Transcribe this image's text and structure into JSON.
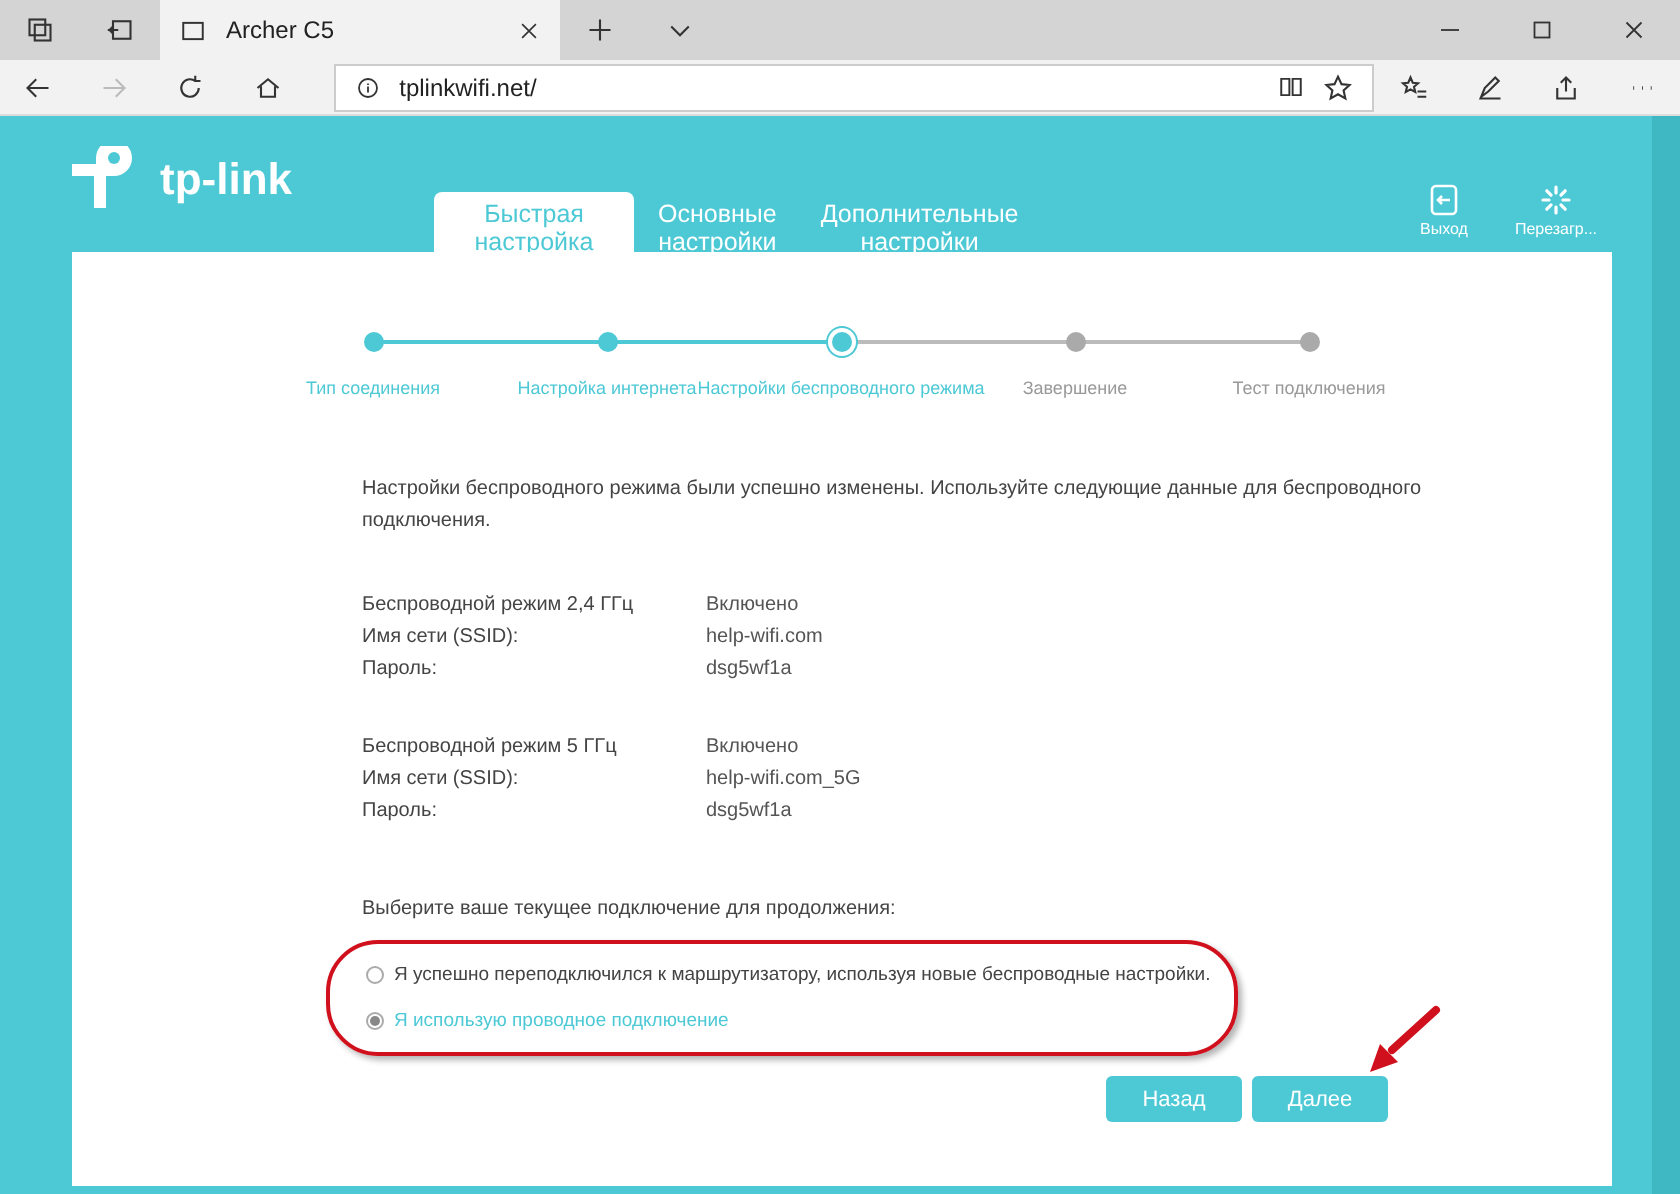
{
  "browser": {
    "tab_title": "Archer C5",
    "url": "tplinkwifi.net/"
  },
  "header": {
    "logo": "tp-link",
    "nav_tabs": [
      {
        "label": "Быстрая настройка",
        "selected": true
      },
      {
        "label": "Основные настройки",
        "selected": false
      },
      {
        "label": "Дополнительные настройки",
        "selected": false
      }
    ],
    "actions": [
      {
        "label": "Выход",
        "kind": "logout"
      },
      {
        "label": "Перезагр...",
        "kind": "reboot"
      }
    ]
  },
  "steps": [
    {
      "label": "Тип соединения",
      "kind": "done"
    },
    {
      "label": "Настройка интернета",
      "kind": "done"
    },
    {
      "label": "Настройки беспроводного режима",
      "kind": "current"
    },
    {
      "label": "Завершение",
      "kind": "pending"
    },
    {
      "label": "Тест подключения",
      "kind": "pending"
    }
  ],
  "message": "Настройки беспроводного режима были успешно изменены. Используйте следующие данные для беспроводного подключения.",
  "sections": [
    {
      "rows": [
        {
          "label": "Беспроводной режим 2,4 ГГц",
          "value": "Включено"
        },
        {
          "label": "Имя сети (SSID):",
          "value": "help-wifi.com"
        },
        {
          "label": "Пароль:",
          "value": "dsg5wf1a"
        }
      ]
    },
    {
      "rows": [
        {
          "label": "Беспроводной режим 5 ГГц",
          "value": "Включено"
        },
        {
          "label": "Имя сети (SSID):",
          "value": "help-wifi.com_5G"
        },
        {
          "label": "Пароль:",
          "value": "dsg5wf1a"
        }
      ]
    }
  ],
  "prompt": "Выберите ваше текущее подключение для продолжения:",
  "options": [
    {
      "label": "Я успешно переподключился к маршрутизатору, используя новые беспроводные настройки.",
      "selected": false
    },
    {
      "label": "Я использую проводное подключение",
      "selected": true
    }
  ],
  "buttons": [
    {
      "label": "Назад"
    },
    {
      "label": "Далее"
    }
  ]
}
